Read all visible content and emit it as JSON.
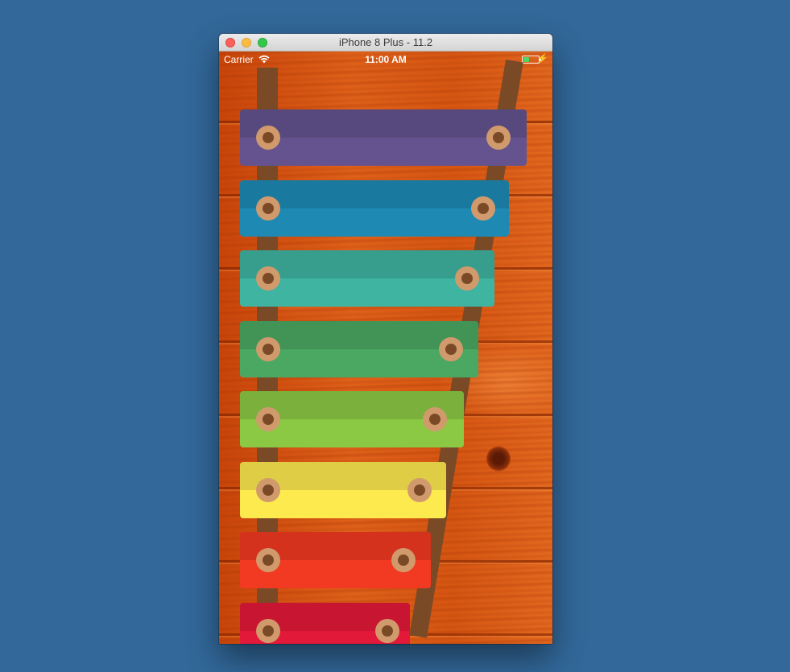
{
  "window": {
    "title": "iPhone 8 Plus - 11.2"
  },
  "status_bar": {
    "carrier": "Carrier",
    "time": "11:00 AM",
    "battery_color": "#4cd964"
  },
  "icons": {
    "wifi": "wifi-icon",
    "battery": "battery-icon",
    "charging": "bolt-icon"
  },
  "xylophone": {
    "rail_color": "#7a4a27",
    "peg_color": "#d19a6c",
    "bars": [
      {
        "key": "bar-1",
        "color": "#64538f"
      },
      {
        "key": "bar-2",
        "color": "#1e8ab4"
      },
      {
        "key": "bar-3",
        "color": "#3fb4a1"
      },
      {
        "key": "bar-4",
        "color": "#4aa862"
      },
      {
        "key": "bar-5",
        "color": "#8bc944"
      },
      {
        "key": "bar-6",
        "color": "#fdea4f"
      },
      {
        "key": "bar-7",
        "color": "#f23a22"
      },
      {
        "key": "bar-8",
        "color": "#e3193a"
      }
    ]
  }
}
